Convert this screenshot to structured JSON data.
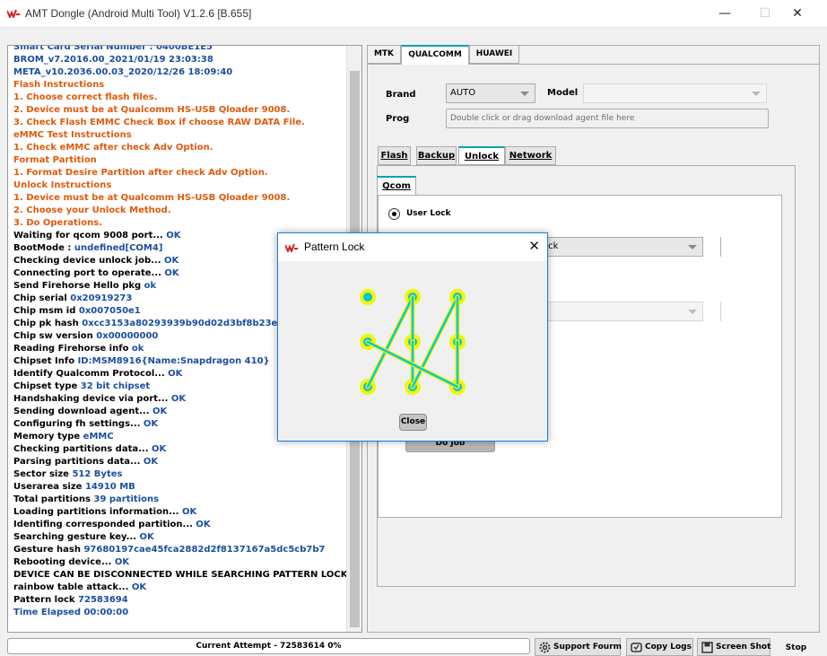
{
  "window": {
    "title": "AMT Dongle (Android Multi Tool) V1.2.6 [B.655]",
    "minimize": "—",
    "maximize": "☐",
    "close": "✕"
  },
  "colors": {
    "accent": "#0aa1b5",
    "log_blue": "#1a4fa0",
    "log_orange": "#e05a0c",
    "log_value": "#1a4fa0",
    "pattern_ring": "#f5f500",
    "pattern_dot": "#00c8d8"
  },
  "log": [
    {
      "text": "Smart Card Serial Number : 0400BE1E5",
      "color": "#1a4fa0"
    },
    {
      "text": "BROM_v7.2016.00_2021/01/19 23:03:38",
      "color": "#1a4fa0"
    },
    {
      "text": "META_v10.2036.00.03_2020/12/26 18:09:40",
      "color": "#1a4fa0"
    },
    {
      "text": "Flash Instructions",
      "color": "#e05a0c"
    },
    {
      "text": "1. Choose correct flash files.",
      "color": "#e05a0c"
    },
    {
      "text": "2. Device must be at Qualcomm HS-USB Qloader 9008.",
      "color": "#e05a0c"
    },
    {
      "text": "3. Check Flash EMMC Check Box if choose RAW DATA File.",
      "color": "#e05a0c"
    },
    {
      "text": "eMMC Test Instructions",
      "color": "#e05a0c"
    },
    {
      "text": "1. Check eMMC after check Adv Option.",
      "color": "#e05a0c"
    },
    {
      "text": "Format Partition",
      "color": "#e05a0c"
    },
    {
      "text": "1. Format Desire Partition after check Adv Option.",
      "color": "#e05a0c"
    },
    {
      "text": "Unlock Instructions",
      "color": "#e05a0c"
    },
    {
      "text": "1. Device must be at Qualcomm HS-USB Qloader 9008.",
      "color": "#e05a0c"
    },
    {
      "text": "2. Choose your Unlock Method.",
      "color": "#e05a0c"
    },
    {
      "text": "3. Do Operations.",
      "color": "#e05a0c"
    },
    {
      "text": "Waiting for qcom 9008 port...",
      "value": "OK",
      "color": "#000000"
    },
    {
      "text": "BootMode :",
      "value": "undefined[COM4]",
      "color": "#000000"
    },
    {
      "text": "Checking device unlock job...",
      "value": "OK",
      "color": "#000000"
    },
    {
      "text": "Connecting port to operate...",
      "value": "OK",
      "color": "#000000"
    },
    {
      "text": "Send Firehorse Hello pkg",
      "value": "ok",
      "color": "#000000"
    },
    {
      "text": "Chip serial",
      "value": "0x20919273",
      "color": "#000000"
    },
    {
      "text": "Chip msm id",
      "value": "0x007050e1",
      "color": "#000000"
    },
    {
      "text": "Chip pk hash",
      "value": "0xcc3153a80293939b90d02d3bf8b23e02",
      "color": "#000000"
    },
    {
      "text": "Chip sw version",
      "value": "0x00000000",
      "color": "#000000"
    },
    {
      "text": "Reading Firehorse info",
      "value": "ok",
      "color": "#000000"
    },
    {
      "text": "Chipset Info",
      "value": "ID:MSM8916{Name:Snapdragon 410}",
      "color": "#000000"
    },
    {
      "text": "Identify Qualcomm Protocol...",
      "value": "OK",
      "color": "#000000"
    },
    {
      "text": "Chipset type",
      "value": "32 bit chipset",
      "color": "#000000"
    },
    {
      "text": "Handshaking device via port...",
      "value": "OK",
      "color": "#000000"
    },
    {
      "text": "Sending download agent...",
      "value": "OK",
      "color": "#000000"
    },
    {
      "text": "Configuring fh settings...",
      "value": "OK",
      "color": "#000000"
    },
    {
      "text": "Memory type",
      "value": "eMMC",
      "color": "#000000"
    },
    {
      "text": "Checking partitions data...",
      "value": "OK",
      "color": "#000000"
    },
    {
      "text": "Parsing partitions data...",
      "value": "OK",
      "color": "#000000"
    },
    {
      "text": "Sector size",
      "value": "512 Bytes",
      "color": "#000000"
    },
    {
      "text": "Userarea size",
      "value": "14910 MB",
      "color": "#000000"
    },
    {
      "text": "Total partitions",
      "value": "39 partitions",
      "color": "#000000"
    },
    {
      "text": "Loading partitions information...",
      "value": "OK",
      "color": "#000000"
    },
    {
      "text": "Identifing corresponded partition...",
      "value": "OK",
      "color": "#000000"
    },
    {
      "text": "Searching gesture key...",
      "value": "OK",
      "color": "#000000"
    },
    {
      "text": "Gesture hash",
      "value": "97680197cae45fca2882d2f8137167a5dc5cb7b7",
      "color": "#000000"
    },
    {
      "text": "Rebooting device...",
      "value": "OK",
      "color": "#000000"
    },
    {
      "text": "DEVICE CAN BE DISCONNECTED WHILE SEARCHING PATTERN LOCK.Making",
      "color": "#000000"
    },
    {
      "text": "rainbow table attack...",
      "value": "OK",
      "color": "#000000"
    },
    {
      "text": "Pattern lock",
      "value": "72583694",
      "color": "#000000"
    },
    {
      "text": "Time Elapsed        00:00:00",
      "color": "#1a4fa0"
    }
  ],
  "top_tabs": [
    {
      "label": "MTK",
      "active": false
    },
    {
      "label": "QUALCOMM",
      "active": true
    },
    {
      "label": "HUAWEI",
      "active": false
    }
  ],
  "form": {
    "brand_label": "Brand",
    "brand_value": "AUTO",
    "model_label": "Model",
    "model_value": "",
    "prog_label": "Prog",
    "prog_placeholder": "Double click or drag download agent file here"
  },
  "sub_tabs": [
    {
      "label": "Flash",
      "active": false
    },
    {
      "label": "Backup",
      "active": false
    },
    {
      "label": "Unlock",
      "active": true
    },
    {
      "label": "Network",
      "active": false
    }
  ],
  "inner_tab": "Qcom",
  "unlock": {
    "radio_label": "User Lock",
    "method_value": "ock",
    "do_job_label": "Do Job"
  },
  "dialog": {
    "title": "Pattern Lock",
    "close_icon": "✕",
    "close_button": "Close",
    "pattern": "72583694"
  },
  "bottom": {
    "status": "Current Attempt - 72583614 0%",
    "support_forum": "Support Fourm",
    "copy_logs": "Copy Logs",
    "screen_shot": "Screen Shot",
    "stop": "Stop"
  }
}
